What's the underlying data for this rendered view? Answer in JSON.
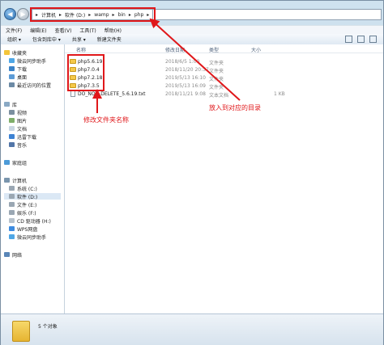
{
  "address": {
    "crumbs": [
      "计算机",
      "软件 (D:)",
      "wamp",
      "bin",
      "php"
    ]
  },
  "menu": [
    "文件(F)",
    "编辑(E)",
    "查看(V)",
    "工具(T)",
    "帮助(H)"
  ],
  "toolbar": [
    "组织 ▾",
    "包含到库中 ▾",
    "共享 ▾",
    "新建文件夹"
  ],
  "nav": {
    "favorites_header": "收藏夹",
    "favorites": [
      "微云同步助手",
      "下载",
      "桌面",
      "最近访问的位置"
    ],
    "libraries_header": "库",
    "libraries": [
      "视频",
      "图片",
      "文档",
      "迅雷下载",
      "音乐"
    ],
    "homegroup": "家庭组",
    "computer_header": "计算机",
    "drives": [
      "系统 (C:)",
      "软件 (D:)",
      "文件 (E:)",
      "娱乐 (F:)",
      "CD 驱动器 (H:)",
      "WPS网盘",
      "微云同步助手"
    ],
    "network": "网络"
  },
  "columns": {
    "name": "名称",
    "date": "修改日期",
    "type": "类型",
    "size": "大小"
  },
  "files": [
    {
      "name": "php5.6.19",
      "date": "2018/6/5 1:00",
      "type": "文件夹",
      "size": "",
      "kind": "folder"
    },
    {
      "name": "php7.0.4",
      "date": "2018/11/20 20:37",
      "type": "文件夹",
      "size": "",
      "kind": "folder"
    },
    {
      "name": "php7.2.18",
      "date": "2019/5/13 16:10",
      "type": "文件夹",
      "size": "",
      "kind": "folder"
    },
    {
      "name": "php7.3.5",
      "date": "2019/5/13 16:09",
      "type": "文件夹",
      "size": "",
      "kind": "folder"
    },
    {
      "name": "DO_NOT_DELETE_5.6.19.txt",
      "date": "2018/11/21 9:08",
      "type": "文本文档",
      "size": "1 KB",
      "kind": "txt"
    }
  ],
  "status": {
    "count": "5 个对象"
  },
  "annotations": {
    "rename": "修改文件夹名称",
    "place": "放入到对应的目录"
  },
  "colors": {
    "annotation": "#e0171a",
    "folder": "#f4c84a"
  }
}
